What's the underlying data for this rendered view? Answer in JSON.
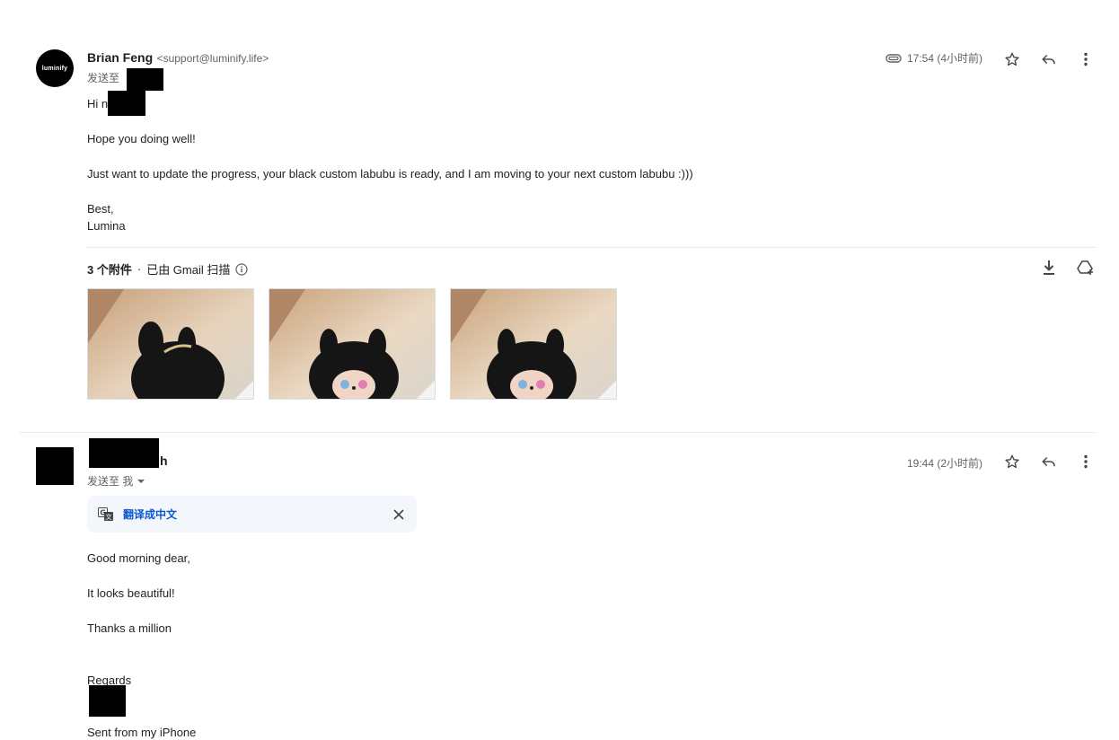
{
  "message1": {
    "avatar_text": "luminify",
    "sender_name": "Brian Feng",
    "sender_email": "<support@luminify.life>",
    "to_prefix": "发送至",
    "time": "17:54 (4小时前)",
    "greeting": "Hi n",
    "lines": [
      "Hope you doing well!",
      "Just want to update the progress, your black custom labubu is ready, and I am moving to your next custom labubu :)))"
    ],
    "sign_off": "Best,",
    "signature": "Lumina",
    "attachments": {
      "count_label": "3 个附件",
      "separator": "·",
      "scanned_label": "已由 Gmail 扫描",
      "items": [
        "attachment-1",
        "attachment-2",
        "attachment-3"
      ]
    }
  },
  "message2": {
    "sender_name_visible": "h",
    "to_label": "发送至 我",
    "time": "19:44 (2小时前)",
    "translate_label": "翻译成中文",
    "lines": [
      "Good morning dear,",
      "It looks beautiful!",
      "Thanks a million"
    ],
    "regards": "Regards",
    "footer": "Sent from my iPhone"
  },
  "colors": {
    "accent_blue": "#0b57d0",
    "text_gray": "#5f6368",
    "divider": "#e6e8eb"
  }
}
